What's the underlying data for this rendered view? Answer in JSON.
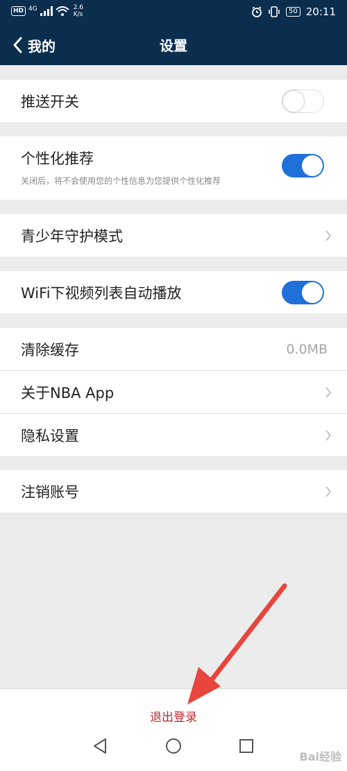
{
  "status_bar": {
    "hd_badge": "HD",
    "signal_type": "4G",
    "network_speed": "2.6",
    "network_unit": "K/s",
    "battery": "50",
    "time": "20:11"
  },
  "header": {
    "back_label": "我的",
    "title": "设置"
  },
  "settings": {
    "push": {
      "label": "推送开关",
      "enabled": false
    },
    "personalized": {
      "label": "个性化推荐",
      "description": "关闭后，将不会使用您的个性信息为您提供个性化推荐",
      "enabled": true
    },
    "teen_mode": {
      "label": "青少年守护模式"
    },
    "wifi_autoplay": {
      "label": "WiFi下视频列表自动播放",
      "enabled": true
    },
    "clear_cache": {
      "label": "清除缓存",
      "value": "0.0MB"
    },
    "about": {
      "label": "关于NBA App"
    },
    "privacy": {
      "label": "隐私设置"
    },
    "delete_account": {
      "label": "注销账号"
    }
  },
  "logout_label": "退出登录",
  "watermark": "Bai经验",
  "colors": {
    "header_bg": "#0b2e4f",
    "toggle_on": "#1f70d8",
    "logout_text": "#c1262b",
    "annotation_arrow": "#e8453c"
  }
}
